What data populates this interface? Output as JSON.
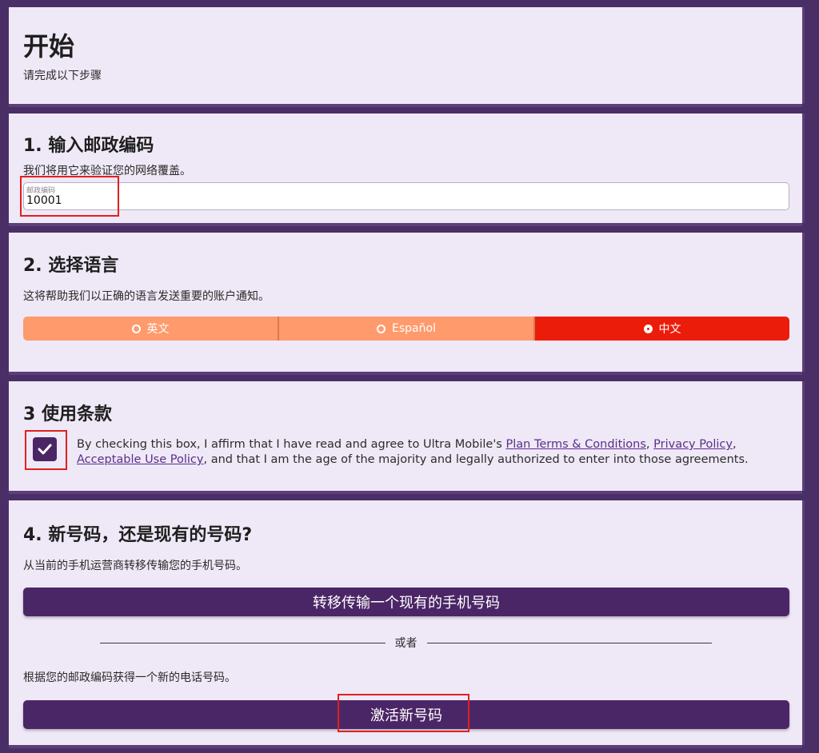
{
  "intro": {
    "title": "开始",
    "subtitle": "请完成以下步骤"
  },
  "zip_section": {
    "title": "1. 输入邮政编码",
    "description": "我们将用它来验证您的网络覆盖。",
    "field_label": "邮政编码",
    "field_value": "10001"
  },
  "language_section": {
    "title": "2. 选择语言",
    "description": "这将帮助我们以正确的语言发送重要的账户通知。",
    "options": [
      {
        "label": "英文",
        "selected": false
      },
      {
        "label": "Español",
        "selected": false
      },
      {
        "label": "中文",
        "selected": true
      }
    ]
  },
  "terms_section": {
    "title": "3 使用条款",
    "checked": true,
    "text_before": "By checking this box, I affirm that I have read and agree to Ultra Mobile's ",
    "link_plan_terms": "Plan Terms & Conditions",
    "sep1": ", ",
    "link_privacy": "Privacy Policy",
    "sep2": ", ",
    "link_acceptable_use": "Acceptable Use Policy",
    "text_after": ", and that I am the age of the majority and legally authorized to enter into those agreements."
  },
  "number_section": {
    "title": "4. 新号码，还是现有的号码?",
    "transfer_description": "从当前的手机运营商转移传输您的手机号码。",
    "transfer_button": "转移传输一个现有的手机号码",
    "divider_text": "或者",
    "new_description": "根据您的邮政编码获得一个新的电话号码。",
    "activate_button": "激活新号码"
  },
  "colors": {
    "background": "#4a2f67",
    "card": "#efe8f6",
    "primary": "#4b2666",
    "lang_option": "#ff9a6c",
    "lang_selected": "#ec1c0a",
    "highlight": "#e02020"
  }
}
